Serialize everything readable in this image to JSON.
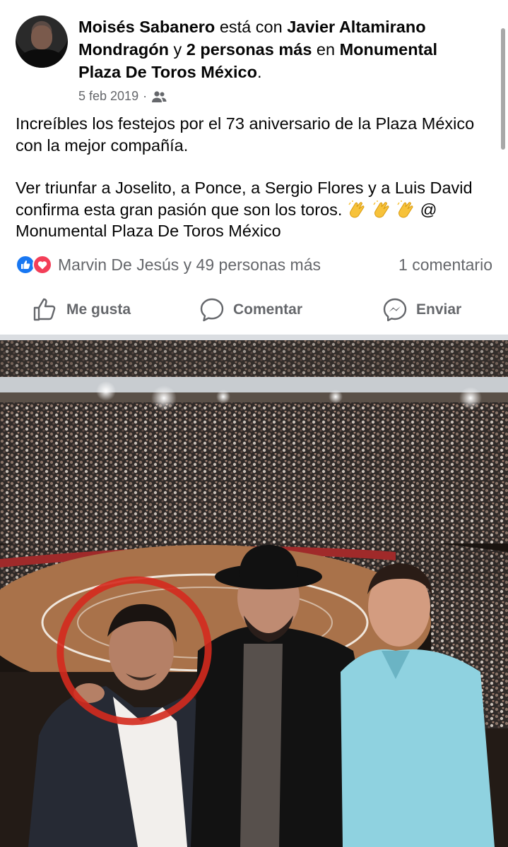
{
  "post": {
    "author": "Moisés Sabanero",
    "with_prefix": "está con",
    "tagged": "Javier Altamirano Mondragón",
    "and": "y",
    "others": "2 personas más",
    "at": "en",
    "place": "Monumental Plaza De Toros México",
    "period": ".",
    "date": "5 feb 2019",
    "date_sep": "·",
    "privacy_icon": "friends-icon",
    "text_line1": "Increíbles los festejos por el 73 aniversario de la Plaza México con la mejor compañía.",
    "text_line2": "Ver triunfar a Joselito, a Ponce, a Sergio Flores y a Luis David confirma esta gran pasión que son los toros.",
    "text_tag": "@ Monumental Plaza De Toros México"
  },
  "reactions": {
    "icons": [
      "like-icon",
      "love-icon"
    ],
    "names": "Marvin De Jesús y 49 personas más",
    "comments": "1 comentario"
  },
  "actions": {
    "like": "Me gusta",
    "comment": "Comentar",
    "send": "Enviar"
  },
  "colors": {
    "like_blue": "#1877f2",
    "love_red": "#f33e58",
    "secondary_text": "#65676b",
    "highlight_circle": "#d42a1e"
  }
}
